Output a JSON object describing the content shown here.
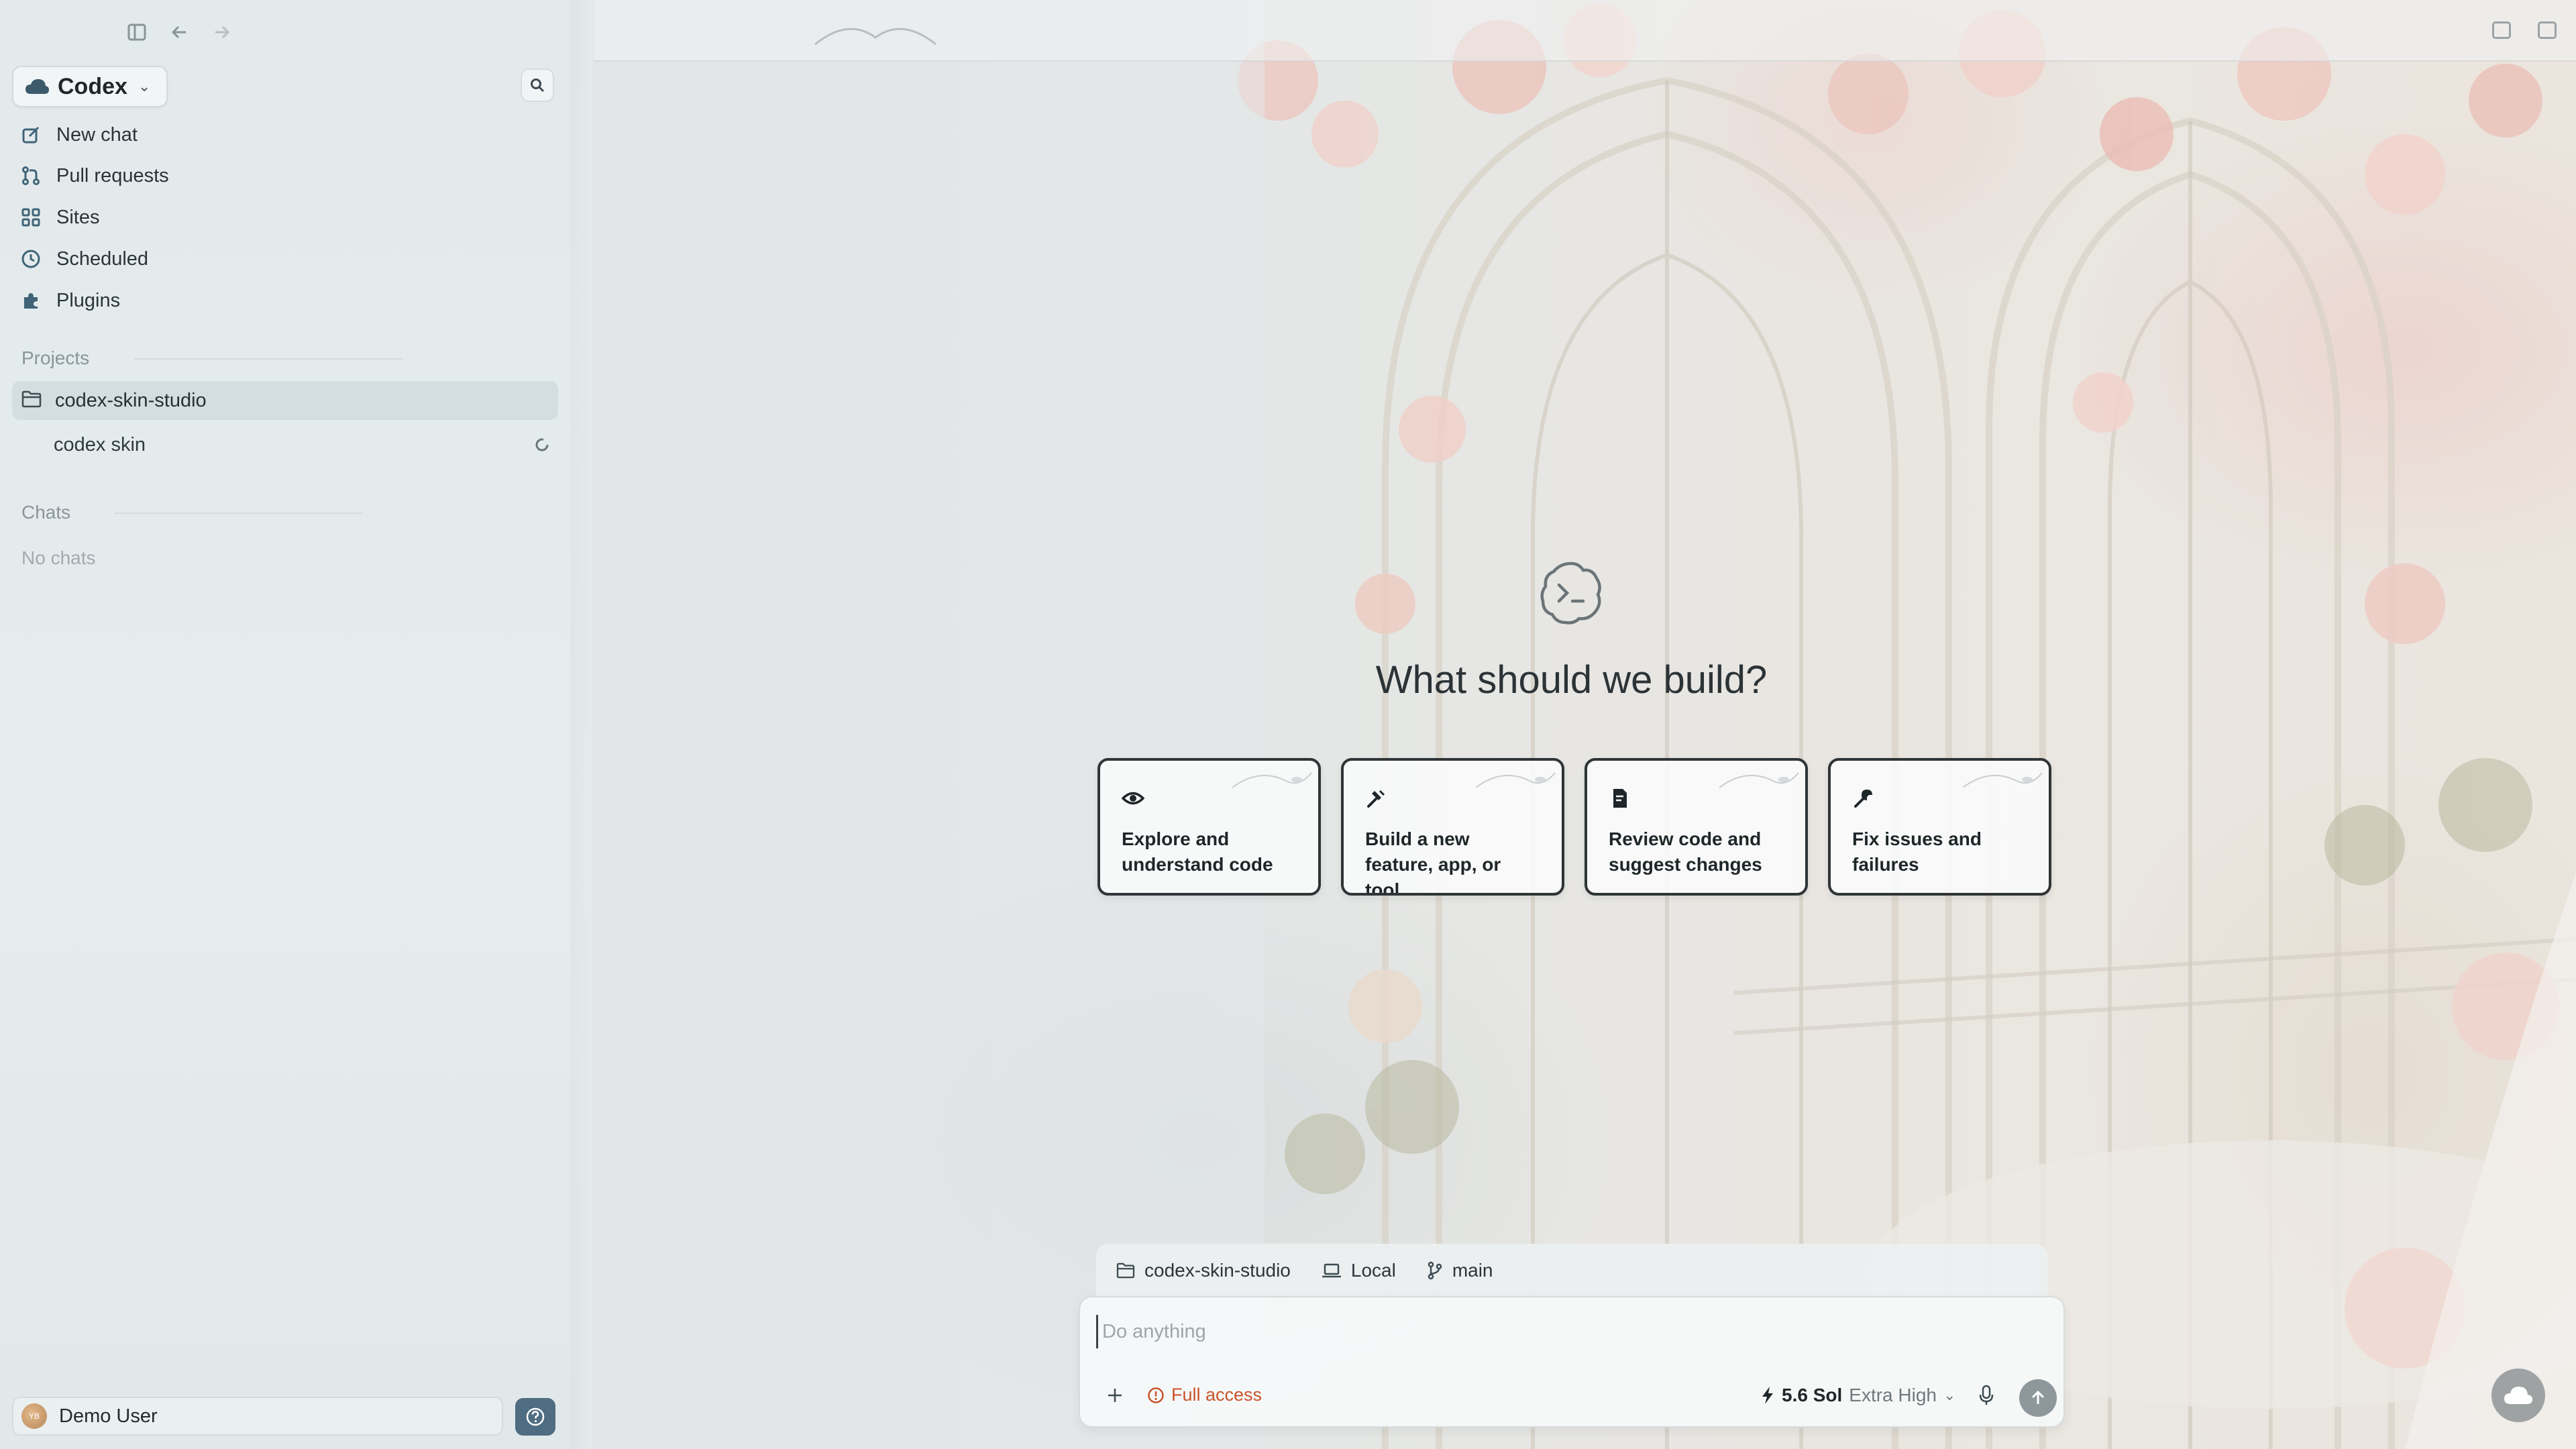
{
  "sidebar": {
    "app_name": "Codex",
    "nav": [
      {
        "label": "New chat",
        "icon": "compose-icon"
      },
      {
        "label": "Pull requests",
        "icon": "pull-request-icon"
      },
      {
        "label": "Sites",
        "icon": "grid-icon"
      },
      {
        "label": "Scheduled",
        "icon": "clock-icon"
      },
      {
        "label": "Plugins",
        "icon": "puzzle-icon"
      }
    ],
    "projects_label": "Projects",
    "project_name": "codex-skin-studio",
    "project_sub": "codex skin",
    "chats_label": "Chats",
    "no_chats": "No chats",
    "user_name": "Demo User",
    "user_initials": "YB"
  },
  "main": {
    "headline": "What should we build?",
    "cards": [
      {
        "label": "Explore and understand code",
        "icon": "eye-icon"
      },
      {
        "label": "Build a new feature, app, or tool",
        "icon": "hammer-icon"
      },
      {
        "label": "Review code and suggest changes",
        "icon": "document-icon"
      },
      {
        "label": "Fix issues and failures",
        "icon": "wrench-icon"
      }
    ]
  },
  "composer": {
    "context_project": "codex-skin-studio",
    "context_env": "Local",
    "context_branch": "main",
    "placeholder": "Do anything",
    "access_label": "Full access",
    "model_name": "5.6 Sol",
    "model_effort": "Extra High"
  },
  "colors": {
    "accent_access": "#c8542c",
    "help_button": "#4e6d82",
    "card_border": "#2f3437"
  }
}
